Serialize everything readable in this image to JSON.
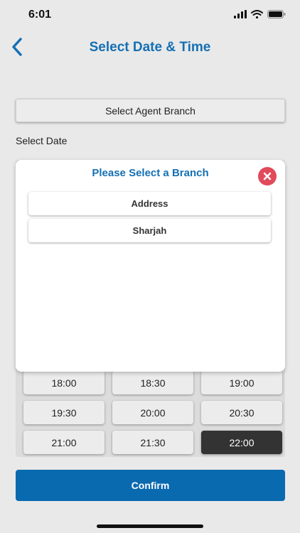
{
  "status_bar": {
    "time": "6:01"
  },
  "nav": {
    "title": "Select Date & Time"
  },
  "form": {
    "branch_button_label": "Select Agent Branch",
    "select_date_label": "Select Date"
  },
  "time_slots": [
    {
      "label": "18:00",
      "selected": false
    },
    {
      "label": "18:30",
      "selected": false
    },
    {
      "label": "19:00",
      "selected": false
    },
    {
      "label": "19:30",
      "selected": false
    },
    {
      "label": "20:00",
      "selected": false
    },
    {
      "label": "20:30",
      "selected": false
    },
    {
      "label": "21:00",
      "selected": false
    },
    {
      "label": "21:30",
      "selected": false
    },
    {
      "label": "22:00",
      "selected": true
    }
  ],
  "modal": {
    "title": "Please Select a Branch",
    "options": [
      "Address",
      "Sharjah"
    ]
  },
  "confirm_label": "Confirm",
  "colors": {
    "accent": "#1470b4",
    "confirm": "#0a6ab0",
    "close": "#e04a5a",
    "selected_slot": "#333333"
  },
  "icons": {
    "back": "chevron-left-icon",
    "close": "close-icon",
    "signal": "signal-icon",
    "wifi": "wifi-icon",
    "battery": "battery-icon"
  }
}
